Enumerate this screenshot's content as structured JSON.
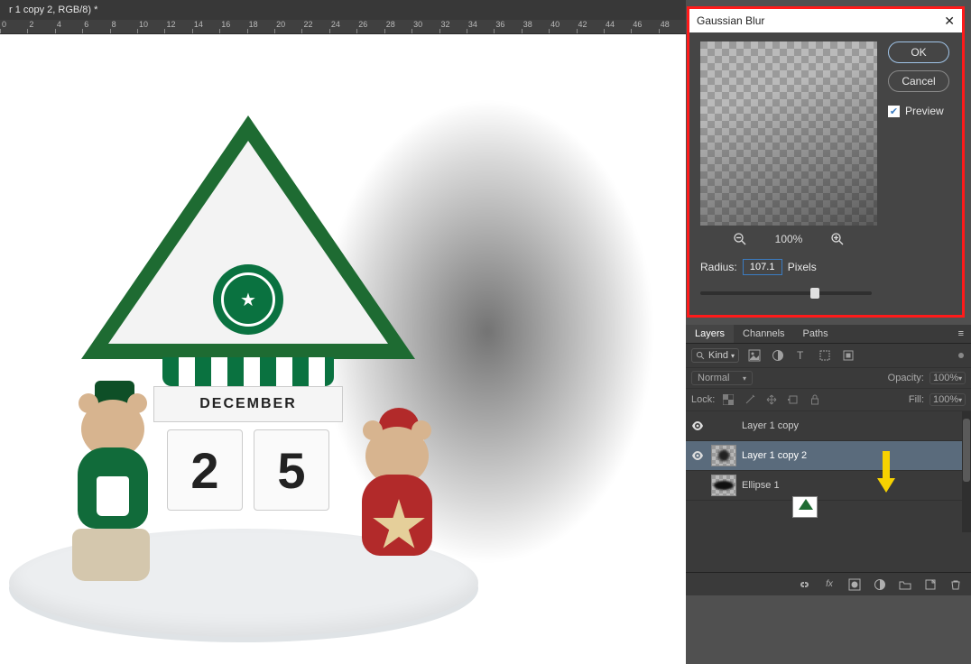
{
  "document": {
    "tab_title": "r 1 copy 2, RGB/8) *",
    "ruler_marks": [
      "0",
      "2",
      "4",
      "6",
      "8",
      "10",
      "12",
      "14",
      "16",
      "18",
      "20",
      "22",
      "24",
      "26",
      "28",
      "30",
      "32",
      "34",
      "36",
      "38",
      "40",
      "42",
      "44",
      "46",
      "48"
    ]
  },
  "artwork": {
    "month": "DECEMBER",
    "day_left": "2",
    "day_right": "5"
  },
  "dialog": {
    "title": "Gaussian Blur",
    "ok": "OK",
    "cancel": "Cancel",
    "preview_label": "Preview",
    "preview_checked": true,
    "zoom_pct": "100%",
    "radius_label": "Radius:",
    "radius_value": "107.1",
    "radius_unit": "Pixels",
    "slider_pct": 67
  },
  "panels": {
    "tabs": {
      "layers": "Layers",
      "channels": "Channels",
      "paths": "Paths"
    },
    "filter": {
      "search_icon": "search-icon",
      "kind_label": "Kind"
    },
    "blend": {
      "mode": "Normal",
      "opacity_label": "Opacity:",
      "opacity_value": "100%"
    },
    "lock": {
      "label": "Lock:",
      "fill_label": "Fill:",
      "fill_value": "100%"
    },
    "layers": [
      {
        "visible": true,
        "name": "Layer 1 copy",
        "thumb": "house",
        "selected": false
      },
      {
        "visible": true,
        "name": "Layer 1 copy 2",
        "thumb": "checker",
        "selected": true
      },
      {
        "visible": false,
        "name": "Ellipse 1",
        "thumb": "ellipse",
        "selected": false
      }
    ],
    "footer_icons": [
      "link",
      "fx",
      "mask",
      "adjustment",
      "group",
      "new",
      "trash"
    ]
  }
}
